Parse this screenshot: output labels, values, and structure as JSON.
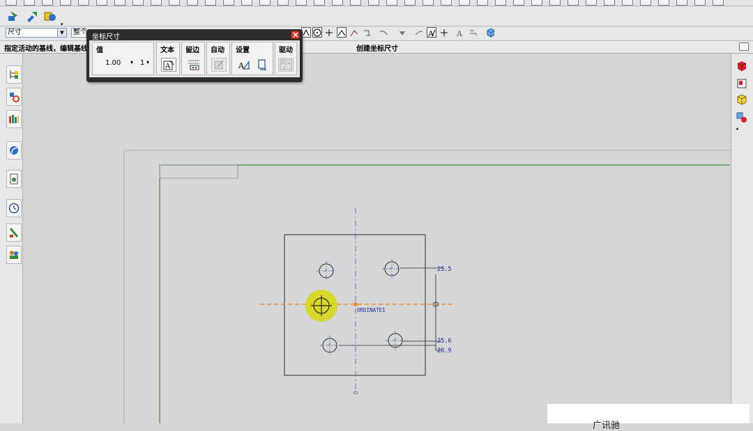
{
  "toolbar": {
    "row1_count": 40,
    "dimension_filter": {
      "value": "尺寸"
    },
    "selection_scope": {
      "value": "整个"
    }
  },
  "status": {
    "prompt": "指定活动的基线，编辑基线",
    "command": "创建坐标尺寸"
  },
  "popup": {
    "title": "坐标尺寸",
    "groups": {
      "value": {
        "label": "值",
        "value": "1.00",
        "decimals": "1"
      },
      "text": {
        "label": "文本"
      },
      "margin": {
        "label": "留边"
      },
      "auto": {
        "label": "自动"
      },
      "settings": {
        "label": "设置"
      },
      "drive": {
        "label": "驱动"
      }
    }
  },
  "left_dock": {
    "icons": [
      "assembly-navigator-icon",
      "part-navigator-icon",
      "roles-palette-icon",
      "reuse-library-icon",
      "web-browser-icon",
      "history-icon",
      "process-studio-icon",
      "team-center-icon"
    ]
  },
  "right_dock": {
    "icons": [
      "render-cube-icon",
      "sheet-icon",
      "view-cube-icon",
      "settings-cubes-icon"
    ]
  },
  "drawing": {
    "dim_labels": [
      "25.5",
      "25.6",
      "28.9"
    ],
    "origin_label": "ORDINATE1",
    "colors": {
      "sheet_border": "#3a8a3a",
      "dimension": "#1c2a9a",
      "centerline": "#6a7aa8",
      "active_baseline": "#f08a2c",
      "highlight": "#d8d800",
      "part_outline": "#2a2a2a"
    }
  },
  "watermark": {
    "text": "广讯驰"
  }
}
